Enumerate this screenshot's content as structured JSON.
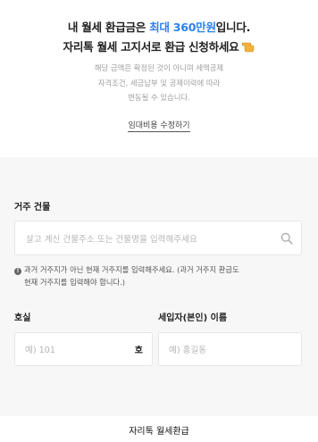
{
  "hero": {
    "line1_prefix": "내 월세 환급금은 ",
    "line1_highlight": "최대 360만원",
    "line1_suffix": "입니다.",
    "line2": "자리톡 월세 고지서로 환급 신청하세요",
    "pointing_emoji": "pointing-hand-icon",
    "notice_lines": [
      "해당 금액은 확정된 것이 아니며 세액공제",
      "자격조건, 세금납부 및 공제이력에 따라",
      "변동될 수 있습니다."
    ],
    "edit_link": "임대비용 수정하기",
    "accent_color": "#2f80ed"
  },
  "form": {
    "building_label": "거주 건물",
    "building_placeholder": "살고 계신 건물주소 또는 건물명을 입력해주세요",
    "info_line1": "과거 거주지가 아닌 현재 거주지를 입력해주세요. (과거 거주지 환급도",
    "info_line2": "현재 거주지를 입력해야 합니다.)",
    "room_label": "호실",
    "room_placeholder": "예) 101",
    "room_unit": "호",
    "tenant_label": "세입자(본인) 이름",
    "tenant_placeholder": "예) 홍길동"
  },
  "footer": {
    "caption": "자리톡 월세환급"
  }
}
